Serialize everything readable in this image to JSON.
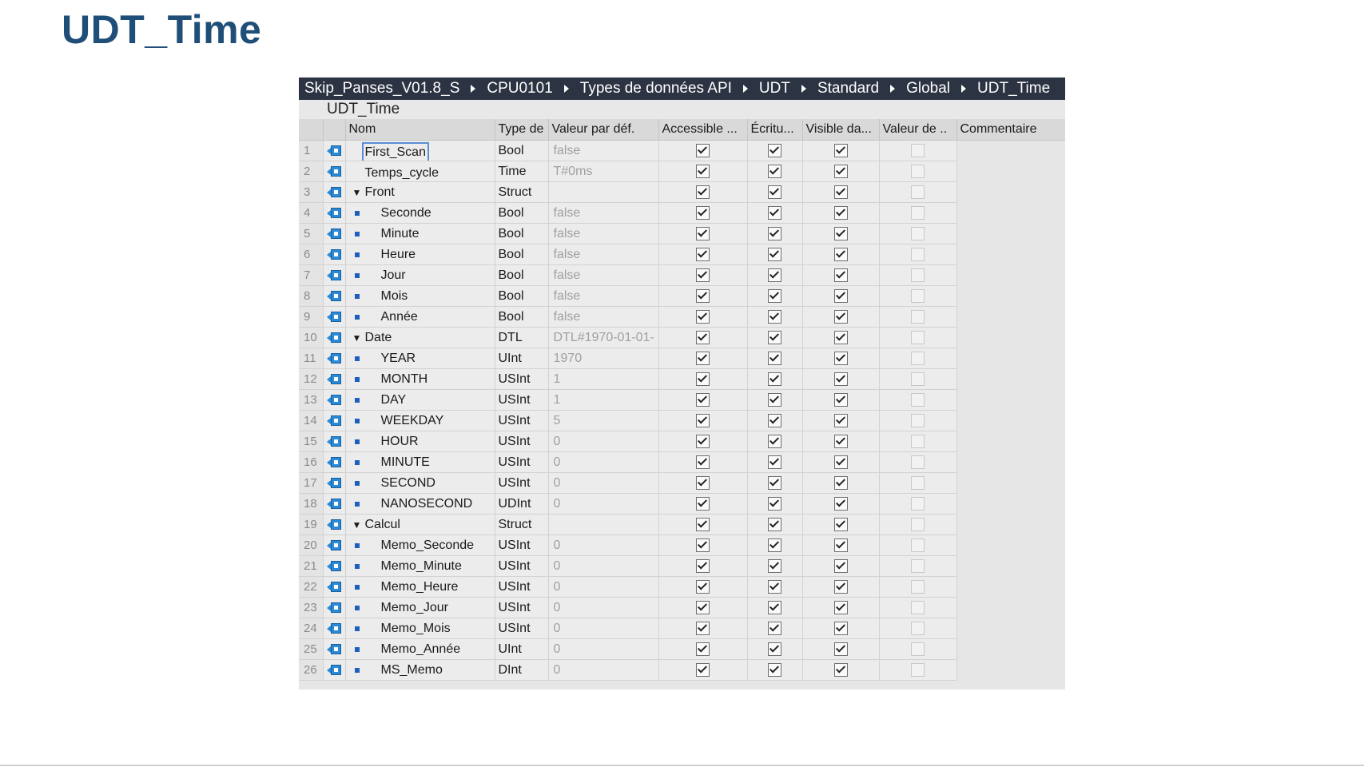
{
  "slide_title": "UDT_Time",
  "breadcrumb": [
    "Skip_Panses_V01.8_S",
    "CPU0101",
    "Types de données API",
    "UDT",
    "Standard",
    "Global",
    "UDT_Time"
  ],
  "block_title": "UDT_Time",
  "columns": {
    "name": "Nom",
    "type": "Type de",
    "default": "Valeur par déf.",
    "accessible": "Accessible ...",
    "write": "Écritu...",
    "visible": "Visible da...",
    "setpoint": "Valeur de ..",
    "comment": "Commentaire"
  },
  "rows": [
    {
      "num": "1",
      "name": "First_Scan",
      "type": "Bool",
      "default": "false",
      "level": 0,
      "expander": "",
      "accessible": true,
      "write": true,
      "visible": true,
      "setpoint": false,
      "selected": true
    },
    {
      "num": "2",
      "name": "Temps_cycle",
      "type": "Time",
      "default": "T#0ms",
      "level": 0,
      "expander": "",
      "accessible": true,
      "write": true,
      "visible": true,
      "setpoint": false
    },
    {
      "num": "3",
      "name": "Front",
      "type": "Struct",
      "default": "",
      "level": 0,
      "expander": "▼",
      "accessible": true,
      "write": true,
      "visible": true,
      "setpoint": false
    },
    {
      "num": "4",
      "name": "Seconde",
      "type": "Bool",
      "default": "false",
      "level": 1,
      "expander": "",
      "accessible": true,
      "write": true,
      "visible": true,
      "setpoint": false
    },
    {
      "num": "5",
      "name": "Minute",
      "type": "Bool",
      "default": "false",
      "level": 1,
      "expander": "",
      "accessible": true,
      "write": true,
      "visible": true,
      "setpoint": false
    },
    {
      "num": "6",
      "name": "Heure",
      "type": "Bool",
      "default": "false",
      "level": 1,
      "expander": "",
      "accessible": true,
      "write": true,
      "visible": true,
      "setpoint": false
    },
    {
      "num": "7",
      "name": "Jour",
      "type": "Bool",
      "default": "false",
      "level": 1,
      "expander": "",
      "accessible": true,
      "write": true,
      "visible": true,
      "setpoint": false
    },
    {
      "num": "8",
      "name": "Mois",
      "type": "Bool",
      "default": "false",
      "level": 1,
      "expander": "",
      "accessible": true,
      "write": true,
      "visible": true,
      "setpoint": false
    },
    {
      "num": "9",
      "name": "Année",
      "type": "Bool",
      "default": "false",
      "level": 1,
      "expander": "",
      "accessible": true,
      "write": true,
      "visible": true,
      "setpoint": false
    },
    {
      "num": "10",
      "name": "Date",
      "type": "DTL",
      "default": "DTL#1970-01-01-",
      "level": 0,
      "expander": "▼",
      "accessible": true,
      "write": true,
      "visible": true,
      "setpoint": false
    },
    {
      "num": "11",
      "name": "YEAR",
      "type": "UInt",
      "default": "1970",
      "level": 1,
      "expander": "",
      "accessible": true,
      "write": true,
      "visible": true,
      "setpoint": false
    },
    {
      "num": "12",
      "name": "MONTH",
      "type": "USInt",
      "default": "1",
      "level": 1,
      "expander": "",
      "accessible": true,
      "write": true,
      "visible": true,
      "setpoint": false
    },
    {
      "num": "13",
      "name": "DAY",
      "type": "USInt",
      "default": "1",
      "level": 1,
      "expander": "",
      "accessible": true,
      "write": true,
      "visible": true,
      "setpoint": false
    },
    {
      "num": "14",
      "name": "WEEKDAY",
      "type": "USInt",
      "default": "5",
      "level": 1,
      "expander": "",
      "accessible": true,
      "write": true,
      "visible": true,
      "setpoint": false
    },
    {
      "num": "15",
      "name": "HOUR",
      "type": "USInt",
      "default": "0",
      "level": 1,
      "expander": "",
      "accessible": true,
      "write": true,
      "visible": true,
      "setpoint": false
    },
    {
      "num": "16",
      "name": "MINUTE",
      "type": "USInt",
      "default": "0",
      "level": 1,
      "expander": "",
      "accessible": true,
      "write": true,
      "visible": true,
      "setpoint": false
    },
    {
      "num": "17",
      "name": "SECOND",
      "type": "USInt",
      "default": "0",
      "level": 1,
      "expander": "",
      "accessible": true,
      "write": true,
      "visible": true,
      "setpoint": false
    },
    {
      "num": "18",
      "name": "NANOSECOND",
      "type": "UDInt",
      "default": "0",
      "level": 1,
      "expander": "",
      "accessible": true,
      "write": true,
      "visible": true,
      "setpoint": false
    },
    {
      "num": "19",
      "name": "Calcul",
      "type": "Struct",
      "default": "",
      "level": 0,
      "expander": "▼",
      "accessible": true,
      "write": true,
      "visible": true,
      "setpoint": false
    },
    {
      "num": "20",
      "name": "Memo_Seconde",
      "type": "USInt",
      "default": "0",
      "level": 1,
      "expander": "",
      "accessible": true,
      "write": true,
      "visible": true,
      "setpoint": false
    },
    {
      "num": "21",
      "name": "Memo_Minute",
      "type": "USInt",
      "default": "0",
      "level": 1,
      "expander": "",
      "accessible": true,
      "write": true,
      "visible": true,
      "setpoint": false
    },
    {
      "num": "22",
      "name": "Memo_Heure",
      "type": "USInt",
      "default": "0",
      "level": 1,
      "expander": "",
      "accessible": true,
      "write": true,
      "visible": true,
      "setpoint": false
    },
    {
      "num": "23",
      "name": "Memo_Jour",
      "type": "USInt",
      "default": "0",
      "level": 1,
      "expander": "",
      "accessible": true,
      "write": true,
      "visible": true,
      "setpoint": false
    },
    {
      "num": "24",
      "name": "Memo_Mois",
      "type": "USInt",
      "default": "0",
      "level": 1,
      "expander": "",
      "accessible": true,
      "write": true,
      "visible": true,
      "setpoint": false
    },
    {
      "num": "25",
      "name": "Memo_Année",
      "type": "UInt",
      "default": "0",
      "level": 1,
      "expander": "",
      "accessible": true,
      "write": true,
      "visible": true,
      "setpoint": false
    },
    {
      "num": "26",
      "name": "MS_Memo",
      "type": "DInt",
      "default": "0",
      "level": 1,
      "expander": "",
      "accessible": true,
      "write": true,
      "visible": true,
      "setpoint": false
    }
  ],
  "colors": {
    "title": "#1f4e79",
    "breadcrumb_bg": "#2c3342",
    "member_icon": "#2a8ad8",
    "child_bullet": "#1d5fbf"
  }
}
